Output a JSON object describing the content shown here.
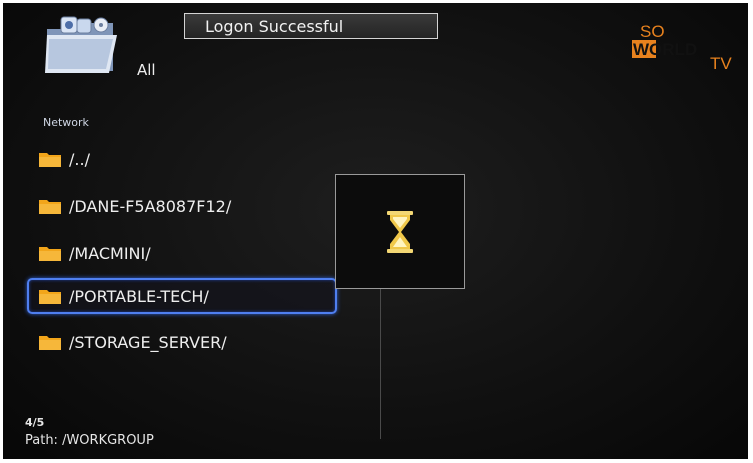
{
  "header": {
    "category_label": "All",
    "toast": "Logon Successful",
    "brand": {
      "line1": "SO",
      "line2": "WORLD",
      "line3": "TV",
      "color": "#e8821e"
    }
  },
  "browser": {
    "section_label": "Network",
    "items": [
      {
        "label": "/../"
      },
      {
        "label": "/DANE-F5A8087F12/"
      },
      {
        "label": "/MACMINI/"
      },
      {
        "label": "/PORTABLE-TECH/"
      },
      {
        "label": "/STORAGE_SERVER/"
      }
    ],
    "selected_index": 3
  },
  "footer": {
    "position": "4/5",
    "path": "Path: /WORKGROUP"
  },
  "icons": {
    "category": "folder-media-icon",
    "item": "folder-icon",
    "busy": "hourglass-icon"
  },
  "colors": {
    "selection": "#4f7ff0",
    "folder": "#f2a51a",
    "hourglass": "#f3d774"
  }
}
